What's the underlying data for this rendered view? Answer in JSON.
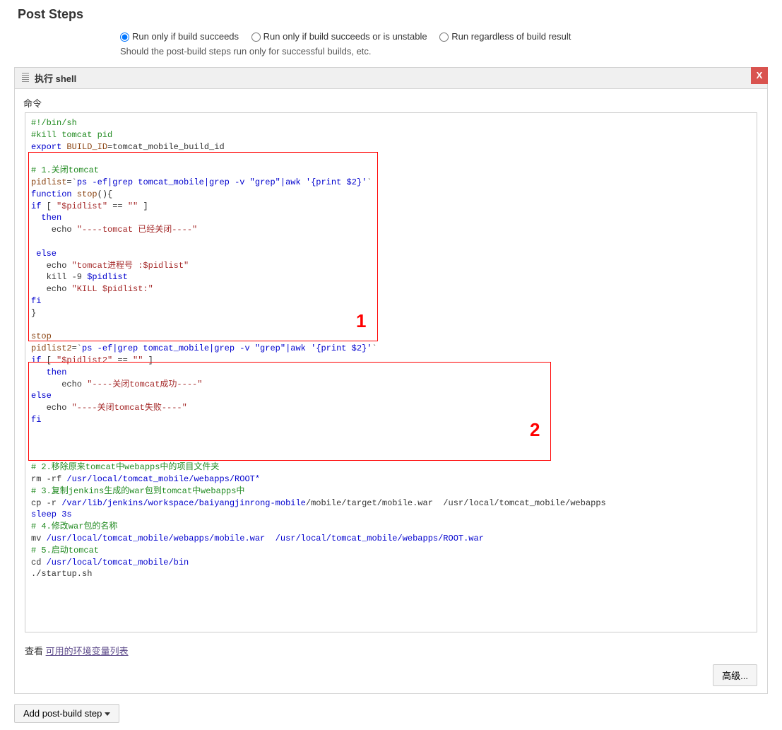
{
  "section_title": "Post Steps",
  "radios": {
    "opt1": "Run only if build succeeds",
    "opt2": "Run only if build succeeds or is unstable",
    "opt3": "Run regardless of build result",
    "selected": 0
  },
  "desc": "Should the post-build steps run only for successful builds, etc.",
  "step": {
    "header": "执行 shell",
    "close": "X",
    "cmd_label": "命令",
    "code": {
      "l01a": "#!/bin/sh",
      "l02a": "#kill tomcat pid",
      "l03a": "export",
      "l03b": " BUILD_ID",
      "l03c": "=tomcat_mobile_build_id",
      "l05a": "# 1.关闭tomcat",
      "l06a": "pidlist",
      "l06b": "=`",
      "l06c": "ps -ef|grep tomcat_mobile|grep -v \"grep\"|awk '{print $2}'",
      "l06d": "`",
      "l07a": "function",
      "l07b": " stop",
      "l07c": "(){",
      "l08a": "if",
      "l08b": " [ ",
      "l08c": "\"$pidlist\"",
      "l08d": " == ",
      "l08e": "\"\"",
      "l08f": " ]",
      "l09a": "  then",
      "l10a": "    echo ",
      "l10b": "\"----tomcat 已经关闭----\"",
      "l12a": " else",
      "l13a": "   echo ",
      "l13b": "\"tomcat进程号 :$pidlist\"",
      "l14a": "   kill -9 ",
      "l14b": "$pidlist",
      "l15a": "   echo ",
      "l15b": "\"KILL $pidlist:\"",
      "l16a": "fi",
      "l17a": "}",
      "l19a": "stop",
      "l20a": "pidlist2",
      "l20b": "=`",
      "l20c": "ps -ef|grep tomcat_mobile|grep -v \"grep\"|awk '{print $2}'",
      "l20d": "`",
      "l21a": "if",
      "l21b": " [ ",
      "l21c": "\"$pidlist2\"",
      "l21d": " == ",
      "l21e": "\"\"",
      "l21f": " ]",
      "l22a": "   then",
      "l23a": "      echo ",
      "l23b": "\"----关闭tomcat成功----\"",
      "l24a": "else",
      "l25a": "   echo ",
      "l25b": "\"----关闭tomcat失败----\"",
      "l26a": "fi",
      "l30a": "# 2.移除原来tomcat中webapps中的项目文件夹",
      "l31a": "rm -rf ",
      "l31b": "/usr/local/tomcat_mobile/webapps/ROOT*",
      "l32a": "# 3.复制jenkins生成的war包到tomcat中webapps中",
      "l33a": "cp -r ",
      "l33b": "/var/lib/jenkins/workspace/baiyangjinrong-mobile",
      "l33c": "/mobile/target/mobile.war  /usr/local/tomcat_mobile/webapps",
      "l34a": "sleep 3s",
      "l35a": "# 4.修改war包的名称",
      "l36a": "mv ",
      "l36b": "/usr/local/tomcat_mobile/webapps/mobile.war  /usr/local/tomcat_mobile/webapps/ROOT.war",
      "l37a": "# 5.启动tomcat",
      "l38a": "cd ",
      "l38b": "/usr/local/tomcat_mobile/bin",
      "l39a": "./startup.sh"
    },
    "annot1": "1",
    "annot2": "2",
    "see_prefix": "查看 ",
    "see_link": "可用的环境变量列表",
    "advanced": "高级...",
    "add_button": "Add post-build step"
  }
}
